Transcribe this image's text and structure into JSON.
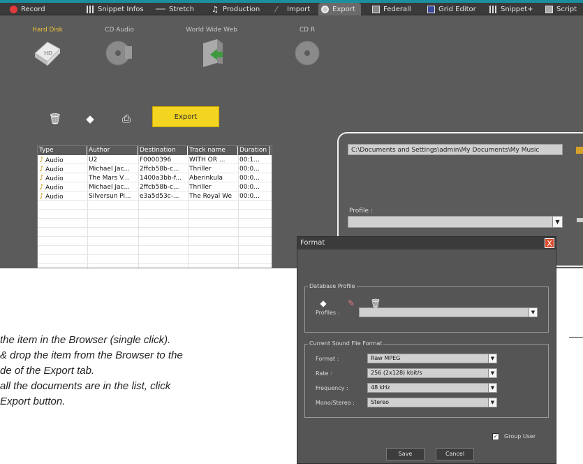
{
  "tabs": [
    {
      "label": "Record",
      "icon": "record-dot-icon"
    },
    {
      "label": "Snippet Infos",
      "icon": "grid-icon"
    },
    {
      "label": "Stretch",
      "icon": "stretch-icon"
    },
    {
      "label": "Production",
      "icon": "note-icon"
    },
    {
      "label": "Import",
      "icon": "import-icon"
    },
    {
      "label": "Export",
      "icon": "export-disc-icon",
      "active": true
    },
    {
      "label": "Federall",
      "icon": "monitor-icon"
    },
    {
      "label": "Grid Editor",
      "icon": "grid-editor-icon"
    },
    {
      "label": "Snippet+",
      "icon": "grid-icon"
    },
    {
      "label": "Script",
      "icon": "script-icon"
    }
  ],
  "media": {
    "hard_disk": "Hard Disk",
    "cd_audio": "CD Audio",
    "www": "World Wide Web",
    "cd_r": "CD R"
  },
  "export_button": "Export",
  "table": {
    "headers": [
      "Type",
      "Author",
      "Destination",
      "Track name",
      "Duration"
    ],
    "rows": [
      [
        "Audio",
        "U2",
        "F0000396",
        "WITH OR ...",
        "00:1..."
      ],
      [
        "Audio",
        "Michael Jac...",
        "2ffcb58b-c...",
        "Thriller",
        "00:0..."
      ],
      [
        "Audio",
        "The Mars V...",
        "1400a3bb-f...",
        "Aberinkula",
        "00:0..."
      ],
      [
        "Audio",
        "Michael Jac...",
        "2ffcb58b-c...",
        "Thriller",
        "00:0..."
      ],
      [
        "Audio",
        "Silversun Pi...",
        "e3a5d53c-...",
        "The Royal We",
        "00:0..."
      ]
    ]
  },
  "right_panel": {
    "path": "C:\\Documents and Settings\\admin\\My Documents\\My Music",
    "profile_label": "Profile :",
    "profile_value": ""
  },
  "instructions": [
    "the item in the Browser (single click).",
    "& drop the item from the Browser to the",
    "de of the Export tab.",
    "all the documents are in the list, click",
    "Export button."
  ],
  "dialog": {
    "title": "Format",
    "database_profile": "Database Profile",
    "profiles_label": "Profiles :",
    "profiles_value": "",
    "sound_format_group": "Current Sound File Format",
    "format_label": "Format :",
    "format_value": "Raw MPEG",
    "rate_label": "Rate :",
    "rate_value": "256 (2x128) kbit/s",
    "frequency_label": "Frequency :",
    "frequency_value": "48 kHz",
    "mono_label": "Mono/Stereo :",
    "mono_value": "Stereo",
    "group_user_label": "Group User",
    "group_user_checked": true,
    "save": "Save",
    "cancel": "Cancel",
    "close": "X"
  }
}
